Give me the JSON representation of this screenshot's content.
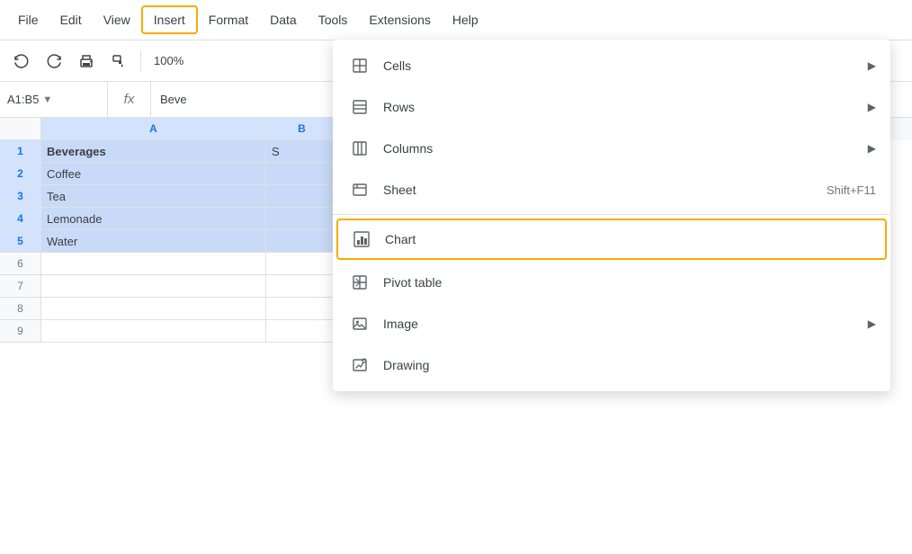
{
  "menubar": {
    "items": [
      {
        "label": "File",
        "active": false
      },
      {
        "label": "Edit",
        "active": false
      },
      {
        "label": "View",
        "active": false
      },
      {
        "label": "Insert",
        "active": true
      },
      {
        "label": "Format",
        "active": false
      },
      {
        "label": "Data",
        "active": false
      },
      {
        "label": "Tools",
        "active": false
      },
      {
        "label": "Extensions",
        "active": false
      },
      {
        "label": "Help",
        "active": false
      }
    ]
  },
  "toolbar": {
    "zoom": "100%"
  },
  "formula_bar": {
    "cell_ref": "A1:B5",
    "formula": "Beve"
  },
  "columns": [
    "A",
    "B"
  ],
  "rows": [
    {
      "num": "1",
      "cells": [
        "Beverages",
        "S"
      ],
      "header": true
    },
    {
      "num": "2",
      "cells": [
        "Coffee",
        ""
      ],
      "header": false
    },
    {
      "num": "3",
      "cells": [
        "Tea",
        ""
      ],
      "header": false
    },
    {
      "num": "4",
      "cells": [
        "Lemonade",
        ""
      ],
      "header": false
    },
    {
      "num": "5",
      "cells": [
        "Water",
        ""
      ],
      "header": false
    },
    {
      "num": "6",
      "cells": [
        "",
        ""
      ],
      "header": false
    },
    {
      "num": "7",
      "cells": [
        "",
        ""
      ],
      "header": false
    },
    {
      "num": "8",
      "cells": [
        "",
        ""
      ],
      "header": false
    },
    {
      "num": "9",
      "cells": [
        "",
        ""
      ],
      "header": false
    }
  ],
  "insert_menu": {
    "items": [
      {
        "id": "cells",
        "label": "Cells",
        "icon": "cells",
        "shortcut": "",
        "has_arrow": true,
        "highlighted": false,
        "divider_after": false
      },
      {
        "id": "rows",
        "label": "Rows",
        "icon": "rows",
        "shortcut": "",
        "has_arrow": true,
        "highlighted": false,
        "divider_after": false
      },
      {
        "id": "columns",
        "label": "Columns",
        "icon": "columns",
        "shortcut": "",
        "has_arrow": true,
        "highlighted": false,
        "divider_after": false
      },
      {
        "id": "sheet",
        "label": "Sheet",
        "icon": "sheet",
        "shortcut": "Shift+F11",
        "has_arrow": false,
        "highlighted": false,
        "divider_after": true
      },
      {
        "id": "chart",
        "label": "Chart",
        "icon": "chart",
        "shortcut": "",
        "has_arrow": false,
        "highlighted": true,
        "divider_after": false
      },
      {
        "id": "pivot_table",
        "label": "Pivot table",
        "icon": "pivot",
        "shortcut": "",
        "has_arrow": false,
        "highlighted": false,
        "divider_after": false
      },
      {
        "id": "image",
        "label": "Image",
        "icon": "image",
        "shortcut": "",
        "has_arrow": true,
        "highlighted": false,
        "divider_after": false
      },
      {
        "id": "drawing",
        "label": "Drawing",
        "icon": "drawing",
        "shortcut": "",
        "has_arrow": false,
        "highlighted": false,
        "divider_after": false
      }
    ]
  },
  "colors": {
    "selected_bg": "#c9daf8",
    "header_selected": "#d3e3fd",
    "highlight_border": "#f9ab00",
    "active_menu_border": "#f9ab00"
  }
}
